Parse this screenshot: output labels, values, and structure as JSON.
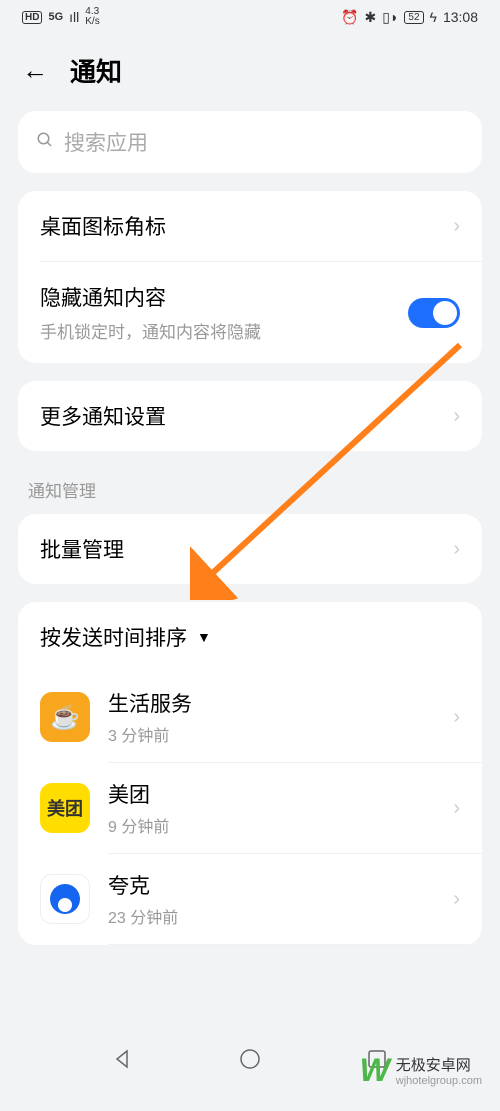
{
  "status": {
    "hd": "HD",
    "signal": "5G",
    "speed_value": "4.3",
    "speed_unit": "K/s",
    "battery": "52",
    "time": "13:08"
  },
  "header": {
    "title": "通知"
  },
  "search": {
    "placeholder": "搜索应用"
  },
  "rows": {
    "badge": "桌面图标角标",
    "hide_title": "隐藏通知内容",
    "hide_subtitle": "手机锁定时，通知内容将隐藏",
    "more": "更多通知设置"
  },
  "section": {
    "label": "通知管理",
    "batch": "批量管理",
    "sort": "按发送时间排序"
  },
  "apps": [
    {
      "name": "生活服务",
      "time": "3 分钟前"
    },
    {
      "name": "美团",
      "time": "9 分钟前",
      "icon_text": "美团"
    },
    {
      "name": "夸克",
      "time": "23 分钟前"
    }
  ],
  "watermark": {
    "brand": "无极安卓网",
    "url": "wjhotelgroup.com"
  }
}
